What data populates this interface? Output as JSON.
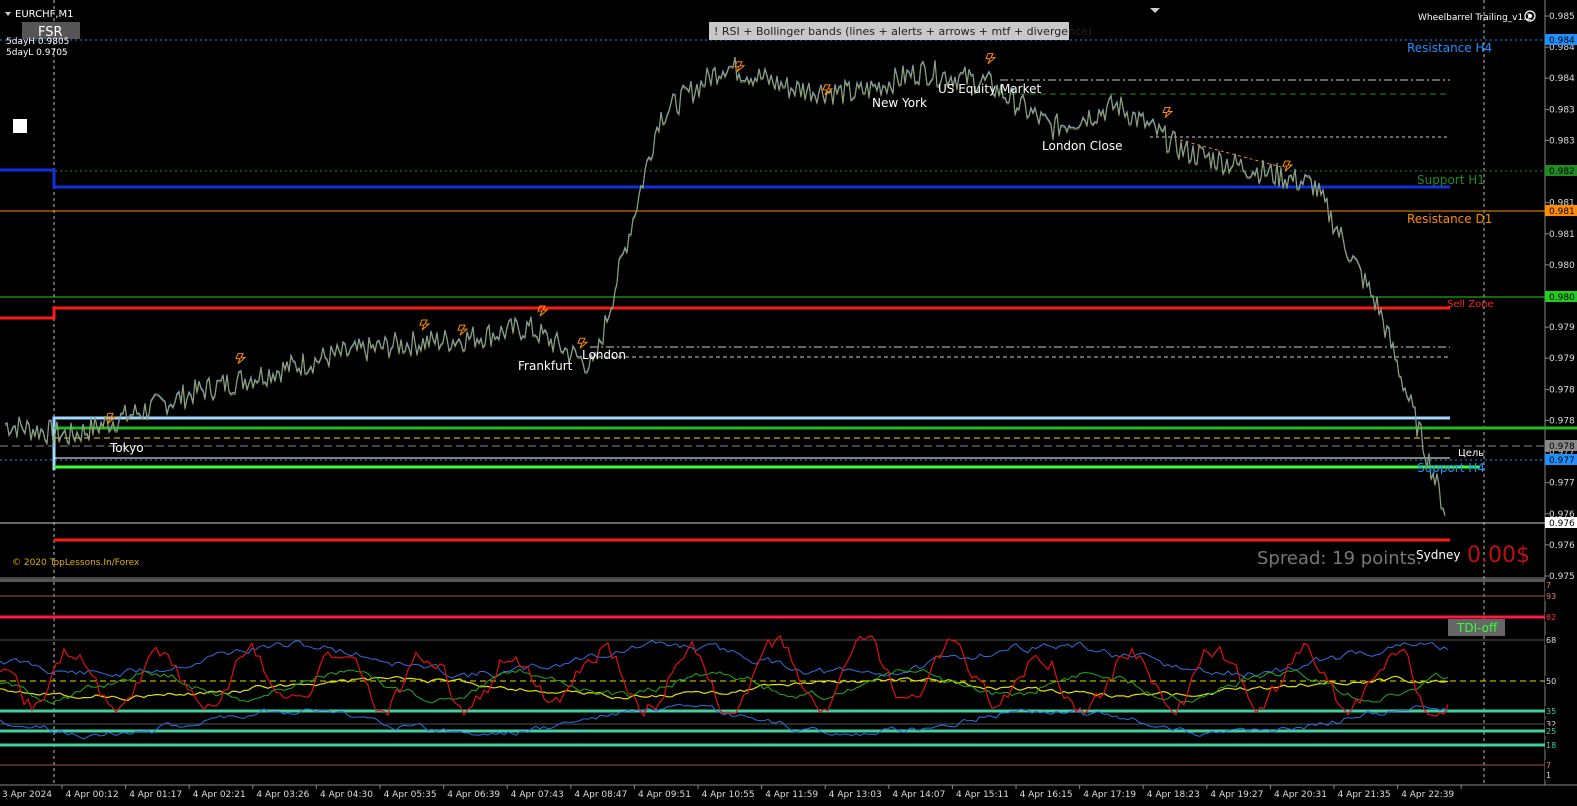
{
  "window": {
    "symbol": "EURCHF,M1",
    "collapse_icon": "triangle-down-icon"
  },
  "top_left": {
    "fsr_button": "FSR",
    "day_high": "5dayH 0.9805",
    "day_low": "5dayL 0.9705"
  },
  "indicator_banner": "! RSI + Bollinger bands  (lines + alerts + arrows + mtf + divergence)",
  "top_right": {
    "title": "Wheelbarrel Trailing_v1.2",
    "settings_icon": "gear-icon"
  },
  "copyright": "© 2020 TopLessons.In/Forex",
  "spread": {
    "text": "Spread: 19 points.",
    "pnl": "0.00$"
  },
  "sessions": [
    "Tokyo",
    "Frankfurt",
    "London",
    "New York",
    "US Equity Market",
    "London Close",
    "Sydney"
  ],
  "levels": [
    {
      "label": "Resistance H4",
      "color": "#1e90ff"
    },
    {
      "label": "Support H1",
      "color": "#1e8c1e"
    },
    {
      "label": "Resistance D1",
      "color": "#ff8c00"
    },
    {
      "label": "Sell Zone",
      "color": "#ff2020"
    },
    {
      "label": "Цель",
      "color": "#ffffff"
    },
    {
      "label": "Support H4",
      "color": "#1e90ff"
    }
  ],
  "price_axis": [
    "0.985",
    "0.984",
    "0.984",
    "0.983",
    "0.983",
    "0.982",
    "0.981",
    "0.981",
    "0.980",
    "0.980",
    "0.979",
    "0.979",
    "0.978",
    "0.978",
    "0.977",
    "0.977",
    "0.976",
    "0.976",
    "0.975"
  ],
  "price_tags": [
    {
      "text": "0.984",
      "color": "#1e90ff"
    },
    {
      "text": "0.982",
      "color": "#1e8c1e"
    },
    {
      "text": "0.981",
      "color": "#ff8c00"
    },
    {
      "text": "0.980",
      "color": "#22cc22"
    },
    {
      "text": "0.978",
      "color": "#888888"
    },
    {
      "text": "0.977",
      "color": "#1e90ff"
    },
    {
      "text": "0.976",
      "color": "#ffffff"
    }
  ],
  "subwindow": {
    "tdi_button": "TDI-off",
    "axis": [
      "7",
      "93",
      "82",
      "68",
      "50",
      "35",
      "32",
      "25",
      "18",
      "7",
      "1"
    ]
  },
  "time_axis": [
    "3 Apr 2024",
    "4 Apr 00:12",
    "4 Apr 01:17",
    "4 Apr 02:21",
    "4 Apr 03:26",
    "4 Apr 04:30",
    "4 Apr 05:35",
    "4 Apr 06:39",
    "4 Apr 07:43",
    "4 Apr 08:47",
    "4 Apr 09:51",
    "4 Apr 10:55",
    "4 Apr 11:59",
    "4 Apr 13:03",
    "4 Apr 14:07",
    "4 Apr 15:11",
    "4 Apr 16:15",
    "4 Apr 17:19",
    "4 Apr 18:23",
    "4 Apr 19:27",
    "4 Apr 20:31",
    "4 Apr 21:35",
    "4 Apr 22:39"
  ],
  "chart_data": {
    "type": "line",
    "symbol": "EURCHF",
    "timeframe": "M1",
    "x": [
      "3 Apr 2024",
      "4 Apr 00:12",
      "4 Apr 01:17",
      "4 Apr 02:21",
      "4 Apr 03:26",
      "4 Apr 04:30",
      "4 Apr 05:35",
      "4 Apr 06:39",
      "4 Apr 07:43",
      "4 Apr 08:47",
      "4 Apr 09:51",
      "4 Apr 10:55",
      "4 Apr 11:59",
      "4 Apr 13:03",
      "4 Apr 14:07",
      "4 Apr 15:11",
      "4 Apr 16:15",
      "4 Apr 17:19",
      "4 Apr 18:23",
      "4 Apr 19:27",
      "4 Apr 20:31",
      "4 Apr 21:35",
      "4 Apr 22:39"
    ],
    "series": [
      {
        "values": [
          0.978,
          0.9778,
          0.9782,
          0.9786,
          0.9789,
          0.9792,
          0.9794,
          0.9795,
          0.9797,
          0.979,
          0.9834,
          0.9843,
          0.9839,
          0.9838,
          0.9842,
          0.984,
          0.9832,
          0.9836,
          0.9828,
          0.9825,
          0.9822,
          0.98,
          0.9765
        ]
      }
    ],
    "ylim": [
      0.9753,
      0.9853
    ]
  }
}
